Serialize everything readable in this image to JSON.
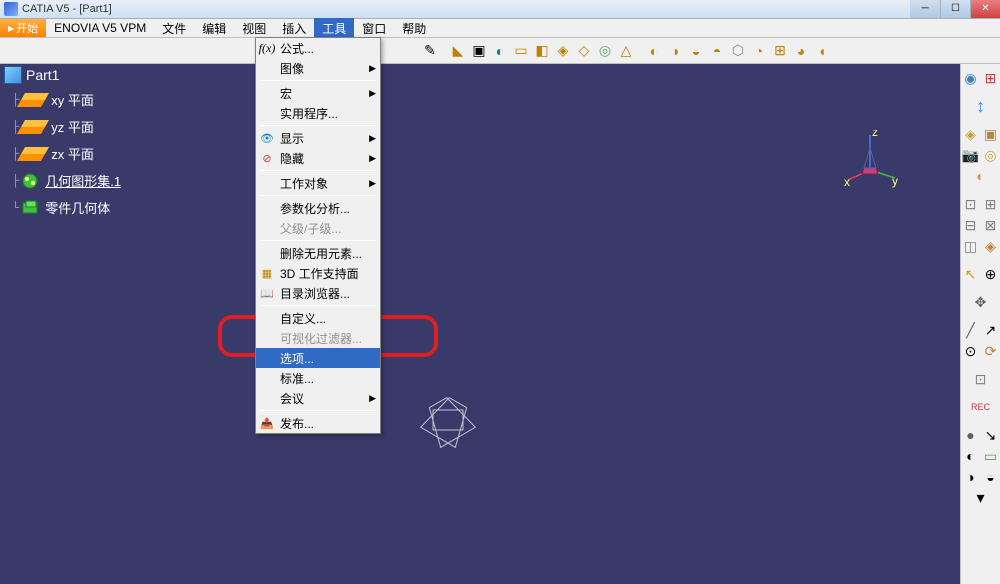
{
  "window": {
    "title": "CATIA V5 - [Part1]"
  },
  "menubar": {
    "start": "开始",
    "items": [
      "ENOVIA V5 VPM",
      "文件",
      "编辑",
      "视图",
      "插入",
      "工具",
      "窗口",
      "帮助"
    ],
    "active_index": 5
  },
  "tree": {
    "root": "Part1",
    "items": [
      {
        "label": "xy 平面",
        "type": "plane"
      },
      {
        "label": "yz 平面",
        "type": "plane"
      },
      {
        "label": "zx 平面",
        "type": "plane"
      },
      {
        "label": "几何图形集.1",
        "type": "geomset",
        "underline": true
      },
      {
        "label": "零件几何体",
        "type": "body"
      }
    ]
  },
  "dropdown": {
    "items": [
      {
        "label": "公式...",
        "icon": "fx"
      },
      {
        "label": "图像",
        "submenu": true
      },
      {
        "sep": true
      },
      {
        "label": "宏",
        "submenu": true
      },
      {
        "label": "实用程序..."
      },
      {
        "sep": true
      },
      {
        "label": "显示",
        "icon": "show",
        "submenu": true
      },
      {
        "label": "隐藏",
        "icon": "hide",
        "submenu": true
      },
      {
        "sep": true
      },
      {
        "label": "工作对象",
        "submenu": true
      },
      {
        "sep": true
      },
      {
        "label": "参数化分析..."
      },
      {
        "label": "父级/子级...",
        "disabled": true
      },
      {
        "sep": true
      },
      {
        "label": "删除无用元素..."
      },
      {
        "label": "3D 工作支持面",
        "icon": "3d"
      },
      {
        "label": "目录浏览器...",
        "icon": "catalog"
      },
      {
        "sep": true
      },
      {
        "label": "自定义..."
      },
      {
        "label": "可视化过滤器...",
        "disabled": true
      },
      {
        "label": "选项...",
        "highlighted": true
      },
      {
        "label": "标准..."
      },
      {
        "label": "会议",
        "submenu": true
      },
      {
        "sep": true
      },
      {
        "label": "发布...",
        "icon": "publish"
      }
    ]
  },
  "axis": {
    "x": "x",
    "y": "y",
    "z": "z"
  }
}
